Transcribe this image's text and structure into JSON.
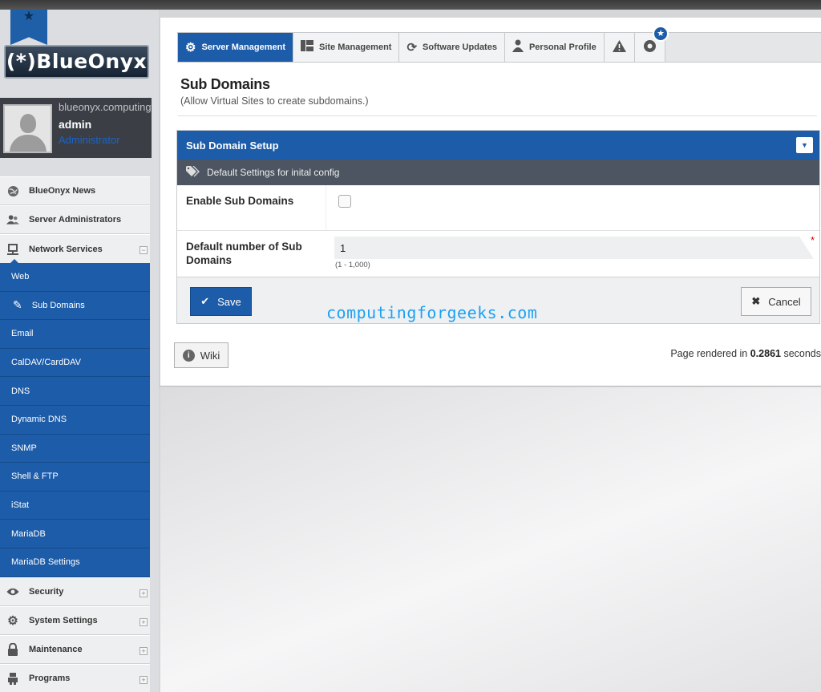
{
  "brand": {
    "logo_text": "(*)BlueOnyx"
  },
  "user": {
    "host": "blueonyx.computingforgeeks.com",
    "name": "admin",
    "role": "Administrator"
  },
  "sidebar": {
    "items_top": [
      {
        "label": "BlueOnyx News",
        "icon": "globe-icon"
      },
      {
        "label": "Server Administrators",
        "icon": "users-icon"
      },
      {
        "label": "Network Services",
        "icon": "network-icon",
        "toggle": "−"
      }
    ],
    "sub_items": [
      {
        "label": "Web"
      },
      {
        "label": "Sub Domains"
      },
      {
        "label": "Email"
      },
      {
        "label": "CalDAV/CardDAV"
      },
      {
        "label": "DNS"
      },
      {
        "label": "Dynamic DNS"
      },
      {
        "label": "SNMP"
      },
      {
        "label": "Shell & FTP"
      },
      {
        "label": "iStat"
      },
      {
        "label": "MariaDB"
      },
      {
        "label": "MariaDB Settings"
      }
    ],
    "items_bottom": [
      {
        "label": "Security",
        "icon": "eye-icon",
        "toggle": "+"
      },
      {
        "label": "System Settings",
        "icon": "gear-icon",
        "toggle": "+"
      },
      {
        "label": "Maintenance",
        "icon": "lock-icon",
        "toggle": "+"
      },
      {
        "label": "Programs",
        "icon": "robot-icon",
        "toggle": "+"
      }
    ]
  },
  "tabs": [
    {
      "label": "Server Management",
      "active": true
    },
    {
      "label": "Site Management"
    },
    {
      "label": "Software Updates"
    },
    {
      "label": "Personal Profile"
    }
  ],
  "page": {
    "title": "Sub Domains",
    "subtitle": "(Allow Virtual Sites to create subdomains.)"
  },
  "form": {
    "header": "Sub Domain Setup",
    "section": "Default Settings for inital config",
    "enable_label": "Enable Sub Domains",
    "enable_checked": false,
    "count_label": "Default number of Sub Domains",
    "count_value": "1",
    "count_hint": "(1 - 1,000)",
    "required_mark": "*",
    "save_label": "Save",
    "cancel_label": "Cancel"
  },
  "watermark": "computingforgeeks.com",
  "footer": {
    "wiki_label": "Wiki",
    "rendered_prefix": "Page rendered in ",
    "rendered_time": "0.2861",
    "rendered_suffix": " seconds"
  },
  "colors": {
    "accent": "#1d5ca8",
    "subhead": "#4c5561",
    "watermark": "#1da1f2"
  }
}
